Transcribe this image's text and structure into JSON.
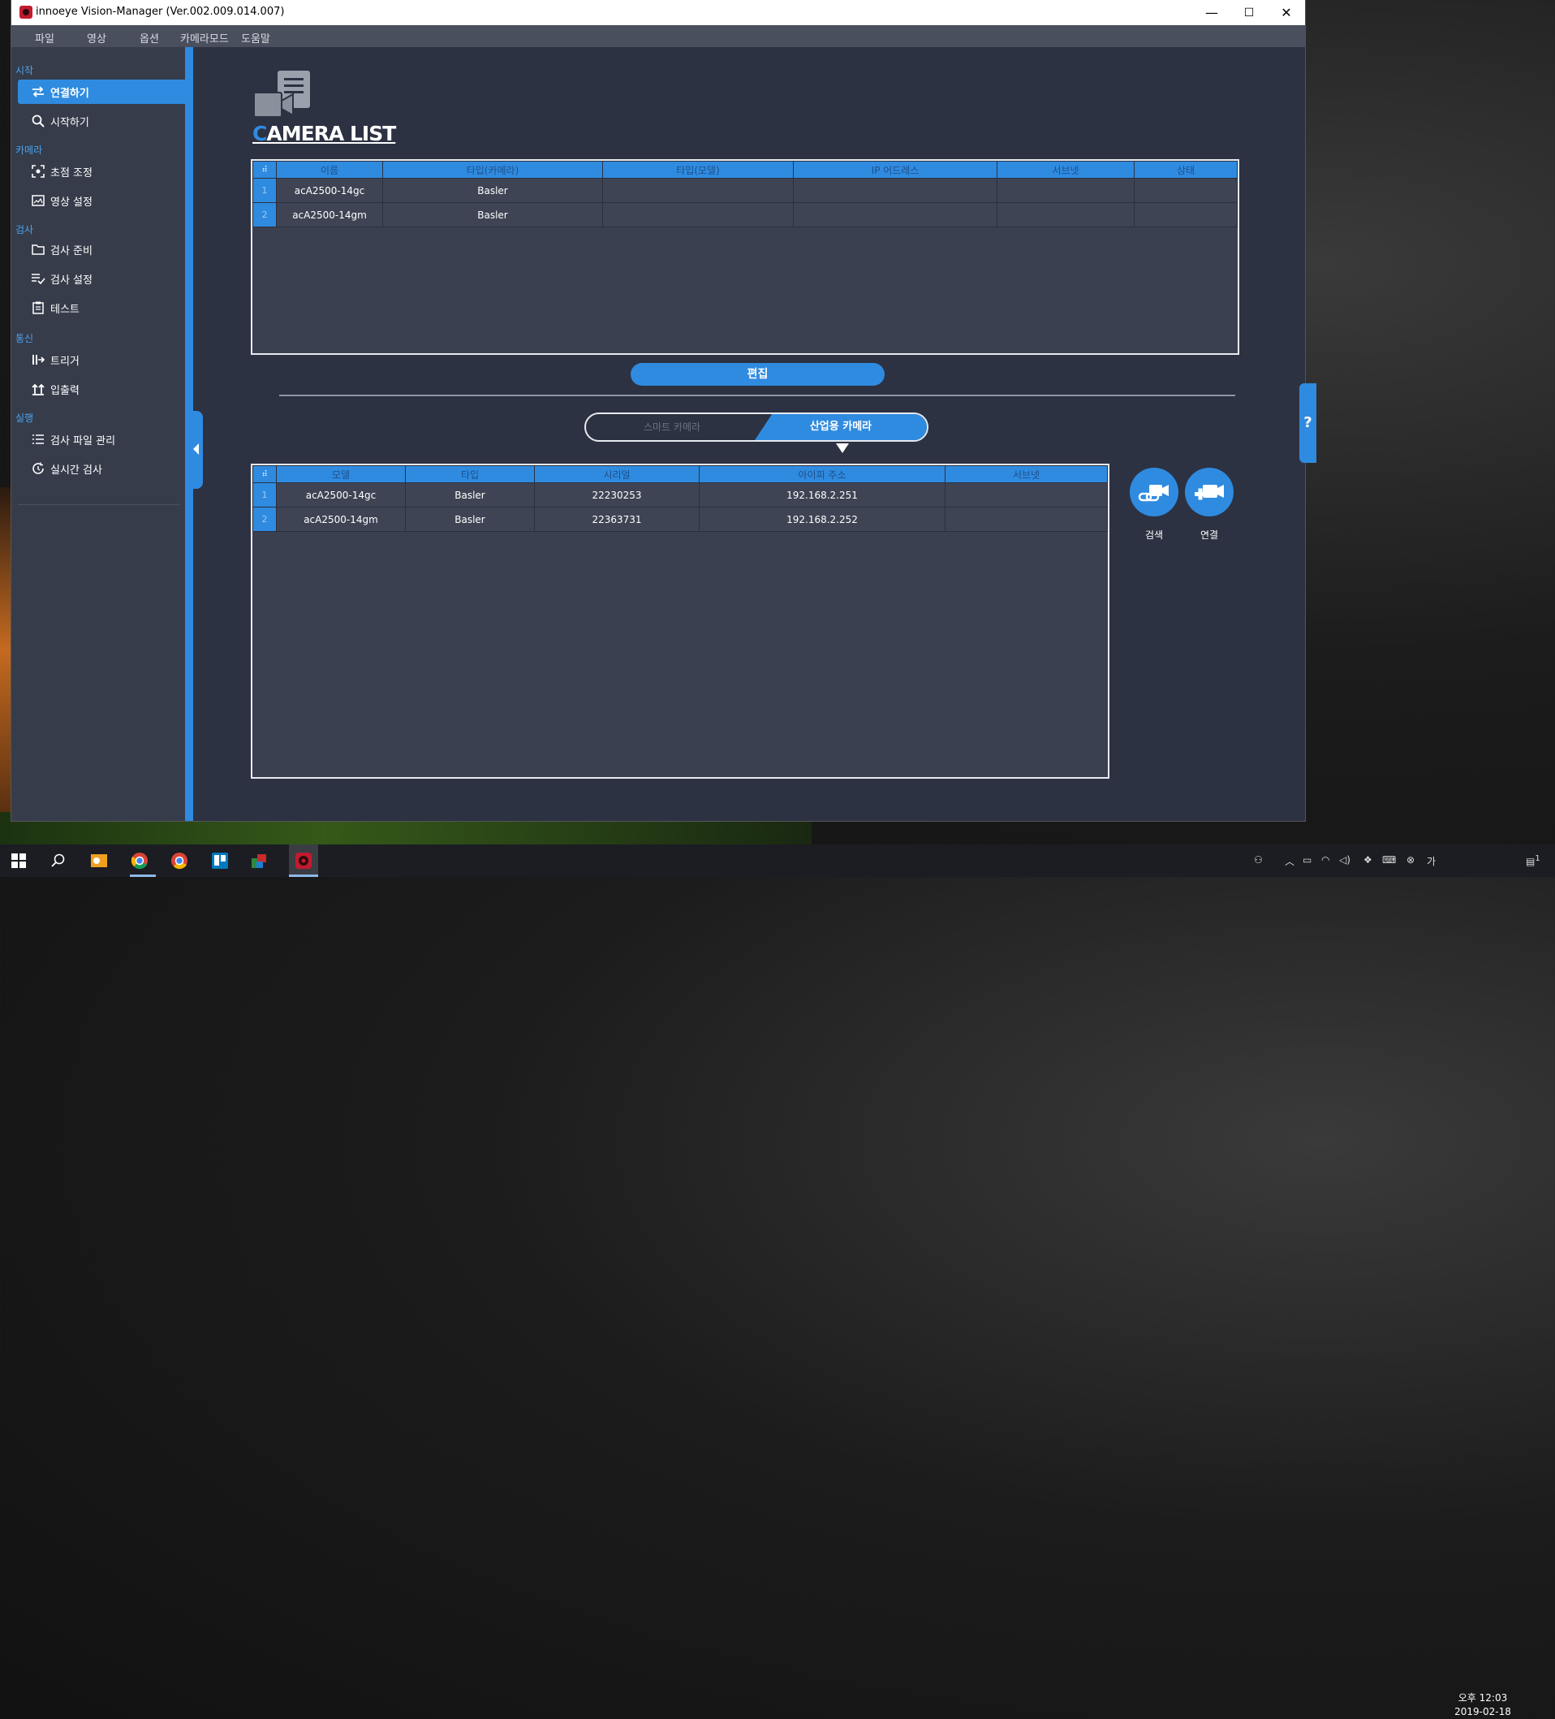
{
  "window": {
    "title": "innoeye Vision-Manager (Ver.002.009.014.007)",
    "minimize": "—",
    "maximize": "☐",
    "close": "✕"
  },
  "menu": [
    "파일",
    "영상",
    "옵션",
    "카메라모드",
    "도움말"
  ],
  "sidebar": {
    "sections": {
      "start": "시작",
      "camera": "카메라",
      "inspect": "검사",
      "comm": "통신",
      "run": "실행"
    },
    "items": [
      {
        "label": "연결하기",
        "icon": "swap-arrows-icon"
      },
      {
        "label": "시작하기",
        "icon": "search-icon"
      },
      {
        "label": "초점 조정",
        "icon": "focus-icon"
      },
      {
        "label": "영상 설정",
        "icon": "image-settings-icon"
      },
      {
        "label": "검사 준비",
        "icon": "folder-icon"
      },
      {
        "label": "검사 설정",
        "icon": "checklist-icon"
      },
      {
        "label": "테스트",
        "icon": "clipboard-icon"
      },
      {
        "label": "트리거",
        "icon": "trigger-icon"
      },
      {
        "label": "입출력",
        "icon": "io-arrows-icon"
      },
      {
        "label": "검사 파일 관리",
        "icon": "list-icon"
      },
      {
        "label": "실시간 검사",
        "icon": "clock-refresh-icon"
      }
    ]
  },
  "camera_list": {
    "title_first": "C",
    "title_rest": "AMERA LIST",
    "corner": "⠾",
    "columns": [
      "이름",
      "타입(카메라)",
      "타입(모델)",
      "IP 어드레스",
      "서브넷",
      "상태"
    ],
    "rows": [
      {
        "num": "1",
        "name": "acA2500-14gc",
        "type_camera": "Basler",
        "type_model": "",
        "ip": "",
        "subnet": "",
        "status": ""
      },
      {
        "num": "2",
        "name": "acA2500-14gm",
        "type_camera": "Basler",
        "type_model": "",
        "ip": "",
        "subnet": "",
        "status": ""
      }
    ]
  },
  "edit_button": "편집",
  "toggle": {
    "smart": "스마트 카메라",
    "industrial": "산업용 카메라"
  },
  "discovered": {
    "corner": "⠾",
    "columns": [
      "모델",
      "타입",
      "시리얼",
      "아이피 주소",
      "서브넷"
    ],
    "rows": [
      {
        "num": "1",
        "model": "acA2500-14gc",
        "type": "Basler",
        "serial": "22230253",
        "ip": "192.168.2.251",
        "subnet": ""
      },
      {
        "num": "2",
        "model": "acA2500-14gm",
        "type": "Basler",
        "serial": "22363731",
        "ip": "192.168.2.252",
        "subnet": ""
      }
    ]
  },
  "actions": {
    "search": "검색",
    "connect": "연결"
  },
  "help": "?",
  "taskbar": {
    "time": "오후 12:03",
    "date": "2019-02-18",
    "notifications": "1"
  },
  "colors": {
    "accent": "#2f8be0",
    "panel": "#2c3242",
    "sidebar": "#363c4a"
  }
}
